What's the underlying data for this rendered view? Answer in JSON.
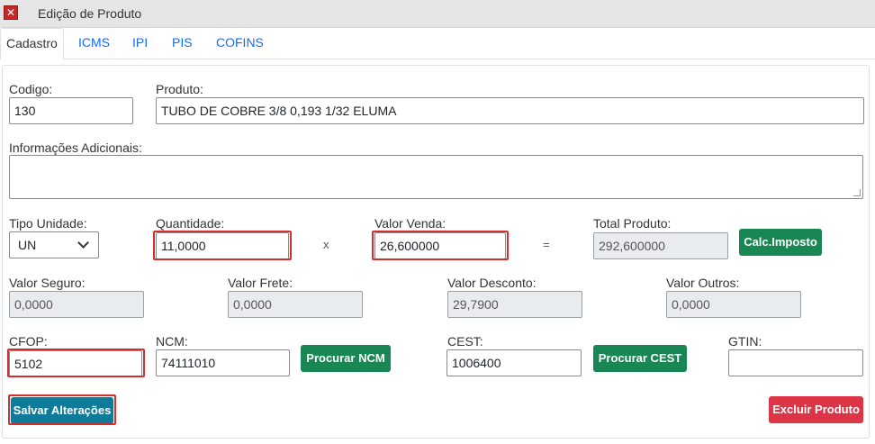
{
  "window": {
    "title": "Edição de Produto",
    "close_icon": "x-icon"
  },
  "tabs": [
    {
      "label": "Cadastro",
      "active": true
    },
    {
      "label": "ICMS"
    },
    {
      "label": "IPI"
    },
    {
      "label": "PIS"
    },
    {
      "label": "COFINS"
    }
  ],
  "form": {
    "codigo": {
      "label": "Codigo:",
      "value": "130"
    },
    "produto": {
      "label": "Produto:",
      "value": "TUBO DE COBRE 3/8 0,193 1/32 ELUMA"
    },
    "info": {
      "label": "Informações Adicionais:",
      "value": ""
    },
    "tipo_unidade": {
      "label": "Tipo Unidade:",
      "value": "UN"
    },
    "quantidade": {
      "label": "Quantidade:",
      "value": "11,0000"
    },
    "times_symbol": "x",
    "valor_venda": {
      "label": "Valor Venda:",
      "value": "26,600000"
    },
    "equals_symbol": "=",
    "total_produto": {
      "label": "Total Produto:",
      "value": "292,600000"
    },
    "calc_button": "Calc.Imposto",
    "valor_seguro": {
      "label": "Valor Seguro:",
      "value": "0,0000"
    },
    "valor_frete": {
      "label": "Valor Frete:",
      "value": "0,0000"
    },
    "valor_desconto": {
      "label": "Valor Desconto:",
      "value": "29,7900"
    },
    "valor_outros": {
      "label": "Valor Outros:",
      "value": "0,0000"
    },
    "cfop": {
      "label": "CFOP:",
      "value": "5102"
    },
    "ncm": {
      "label": "NCM:",
      "value": "74111010"
    },
    "procurar_ncm": "Procurar NCM",
    "cest": {
      "label": "CEST:",
      "value": "1006400"
    },
    "procurar_cest": "Procurar CEST",
    "gtin": {
      "label": "GTIN:",
      "value": ""
    }
  },
  "actions": {
    "save": "Salvar Alterações",
    "delete": "Excluir Produto"
  },
  "colors": {
    "green": "#198754",
    "red": "#dc3545",
    "teal": "#0f7b9a",
    "highlight": "#d32f2f",
    "link": "#0d6efd"
  }
}
